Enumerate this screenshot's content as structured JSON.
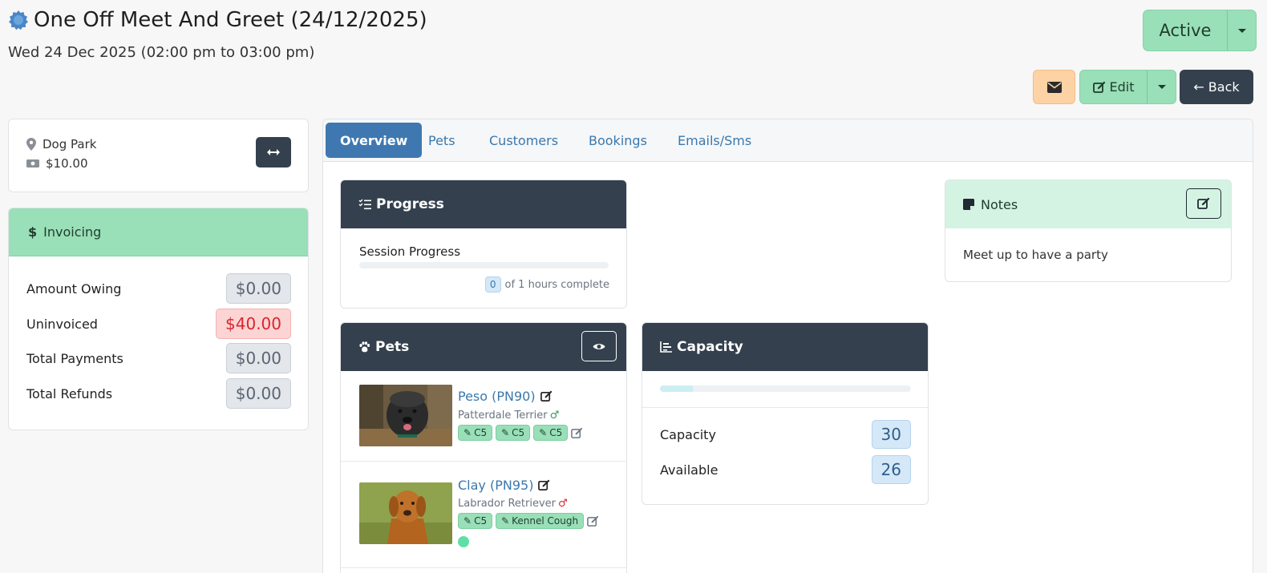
{
  "header": {
    "title": "One Off Meet And Greet (24/12/2025)",
    "subtitle": "Wed 24 Dec 2025 (02:00 pm to 03:00 pm)",
    "status_label": "Active",
    "edit_label": "Edit",
    "back_label": "Back"
  },
  "location": {
    "place": "Dog Park",
    "price": "$10.00"
  },
  "invoicing": {
    "title": "Invoicing",
    "rows": [
      {
        "label": "Amount Owing",
        "value": "$0.00"
      },
      {
        "label": "Uninvoiced",
        "value": "$40.00"
      },
      {
        "label": "Total Payments",
        "value": "$0.00"
      },
      {
        "label": "Total Refunds",
        "value": "$0.00"
      }
    ]
  },
  "tabs": [
    "Overview",
    "Pets",
    "Customers",
    "Bookings",
    "Emails/Sms"
  ],
  "progress": {
    "title": "Progress",
    "label": "Session Progress",
    "completed": "0",
    "suffix": "of 1 hours complete",
    "fraction": 0
  },
  "notes": {
    "title": "Notes",
    "text": "Meet up to have a party"
  },
  "pets": {
    "title": "Pets",
    "items": [
      {
        "name": "Peso (PN90)",
        "breed": "Patterdale Terrier",
        "tags": [
          "C5",
          "C5",
          "C5"
        ]
      },
      {
        "name": "Clay (PN95)",
        "breed": "Labrador Retriever",
        "tags": [
          "C5",
          "Kennel Cough"
        ]
      }
    ]
  },
  "capacity": {
    "title": "Capacity",
    "fraction": 0.13,
    "rows": [
      {
        "label": "Capacity",
        "value": "30"
      },
      {
        "label": "Available",
        "value": "26"
      }
    ]
  },
  "colors": {
    "accent_blue": "#3f78b0",
    "dark": "#34404d",
    "green": "#99dfb8",
    "orange": "#fdd2a5",
    "red": "#d8262d"
  }
}
